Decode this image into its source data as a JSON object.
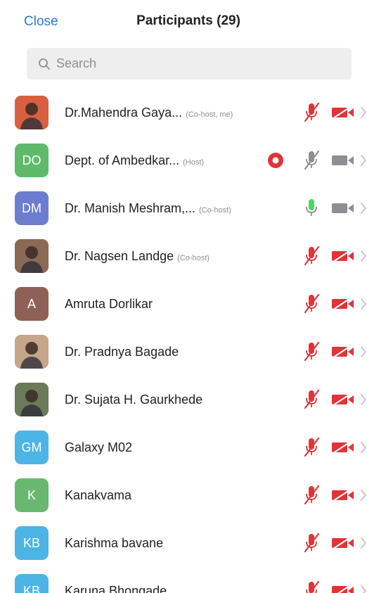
{
  "header": {
    "close_label": "Close",
    "title": "Participants (29)"
  },
  "search": {
    "placeholder": "Search"
  },
  "participants": [
    {
      "avatar_type": "photo",
      "avatar_initials": "",
      "avatar_color": "#d9603f",
      "name": "Dr.Mahendra Gaya...",
      "role": "(Co-host, me)",
      "recording": false,
      "mic": "muted",
      "video": "off"
    },
    {
      "avatar_type": "initials",
      "avatar_initials": "DO",
      "avatar_color": "#5fb96b",
      "name": "Dept. of Ambedkar...",
      "role": "(Host)",
      "recording": true,
      "mic": "muted-gray",
      "video": "on-gray"
    },
    {
      "avatar_type": "initials",
      "avatar_initials": "DM",
      "avatar_color": "#6c7dd0",
      "name": "Dr. Manish Meshram,...",
      "role": "(Co-host)",
      "recording": false,
      "mic": "active",
      "video": "on-gray"
    },
    {
      "avatar_type": "photo",
      "avatar_initials": "",
      "avatar_color": "#8a6a55",
      "name": "Dr. Nagsen Landge",
      "role": "(Co-host)",
      "recording": false,
      "mic": "muted",
      "video": "off"
    },
    {
      "avatar_type": "initials",
      "avatar_initials": "A",
      "avatar_color": "#8d6156",
      "name": "Amruta Dorlikar",
      "role": "",
      "recording": false,
      "mic": "muted",
      "video": "off"
    },
    {
      "avatar_type": "photo",
      "avatar_initials": "",
      "avatar_color": "#c7a58a",
      "name": "Dr. Pradnya Bagade",
      "role": "",
      "recording": false,
      "mic": "muted",
      "video": "off"
    },
    {
      "avatar_type": "photo",
      "avatar_initials": "",
      "avatar_color": "#6b7a5a",
      "name": "Dr. Sujata H. Gaurkhede",
      "role": "",
      "recording": false,
      "mic": "muted",
      "video": "off"
    },
    {
      "avatar_type": "initials",
      "avatar_initials": "GM",
      "avatar_color": "#4db4e6",
      "name": "Galaxy M02",
      "role": "",
      "recording": false,
      "mic": "muted",
      "video": "off"
    },
    {
      "avatar_type": "initials",
      "avatar_initials": "K",
      "avatar_color": "#68b86f",
      "name": "Kanakvama",
      "role": "",
      "recording": false,
      "mic": "muted",
      "video": "off"
    },
    {
      "avatar_type": "initials",
      "avatar_initials": "KB",
      "avatar_color": "#4db4e6",
      "name": "Karishma bavane",
      "role": "",
      "recording": false,
      "mic": "muted",
      "video": "off"
    },
    {
      "avatar_type": "initials",
      "avatar_initials": "KB",
      "avatar_color": "#4db4e6",
      "name": "Karuna Bhongade",
      "role": "",
      "recording": false,
      "mic": "muted",
      "video": "off"
    }
  ],
  "colors": {
    "accent": "#2a77d4",
    "muted_red": "#e0343a",
    "icon_gray": "#8e8e93",
    "mic_active": "#4cd964",
    "record_red": "#e0343a"
  }
}
